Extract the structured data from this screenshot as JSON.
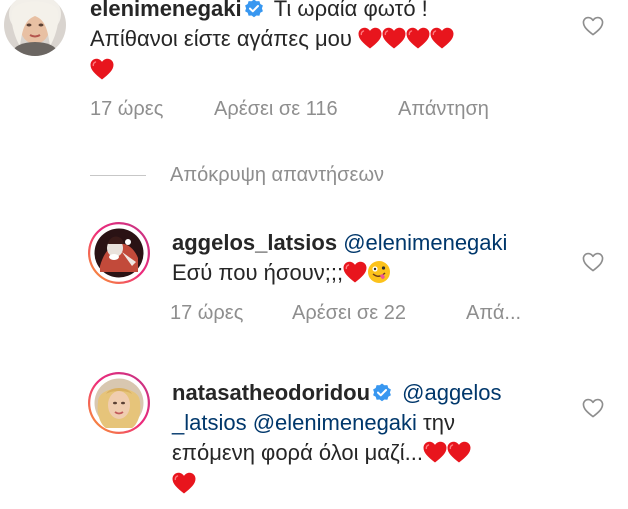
{
  "comments": [
    {
      "username": "elenimenegaki",
      "verified": true,
      "text": "Τι ωραία φωτό ! Απίθανοι είστε αγάπες μου",
      "text_line1": "Τι ωραία φωτό !",
      "text_line2": "Απίθανοι είστε αγάπες μου",
      "emojis": [
        "heart",
        "heart",
        "heart",
        "heart",
        "heart"
      ],
      "time": "17 ώρες",
      "likes": "Αρέσει σε 116",
      "reply": "Απάντηση"
    },
    {
      "username": "aggelos_latsios",
      "verified": false,
      "mention": "@elenimenegaki",
      "text": "Εσύ που ήσουν;;;",
      "emojis": [
        "heart",
        "zany-face"
      ],
      "time": "17 ώρες",
      "likes": "Αρέσει σε 22",
      "reply": "Απά..."
    },
    {
      "username": "natasatheodoridou",
      "verified": true,
      "mention1_part1": "@aggelos",
      "mention1_part2": "_latsios",
      "mention2": "@elenimenegaki",
      "text_after_mention": " την",
      "text_line3": "επόμενη φορά όλοι μαζί...",
      "emojis": [
        "heart",
        "heart",
        "heart"
      ]
    }
  ],
  "hide_replies_label": "Απόκρυψη απαντήσεων",
  "colors": {
    "text": "#262626",
    "meta": "#8e8e8e",
    "mention": "#00376b",
    "heart": "#ed1c24",
    "verified": "#3897f0",
    "story_ring_start": "#f58529",
    "story_ring_end": "#dd2a7b"
  },
  "icons": {
    "like": "heart-outline-icon",
    "verified": "verified-badge-icon"
  }
}
